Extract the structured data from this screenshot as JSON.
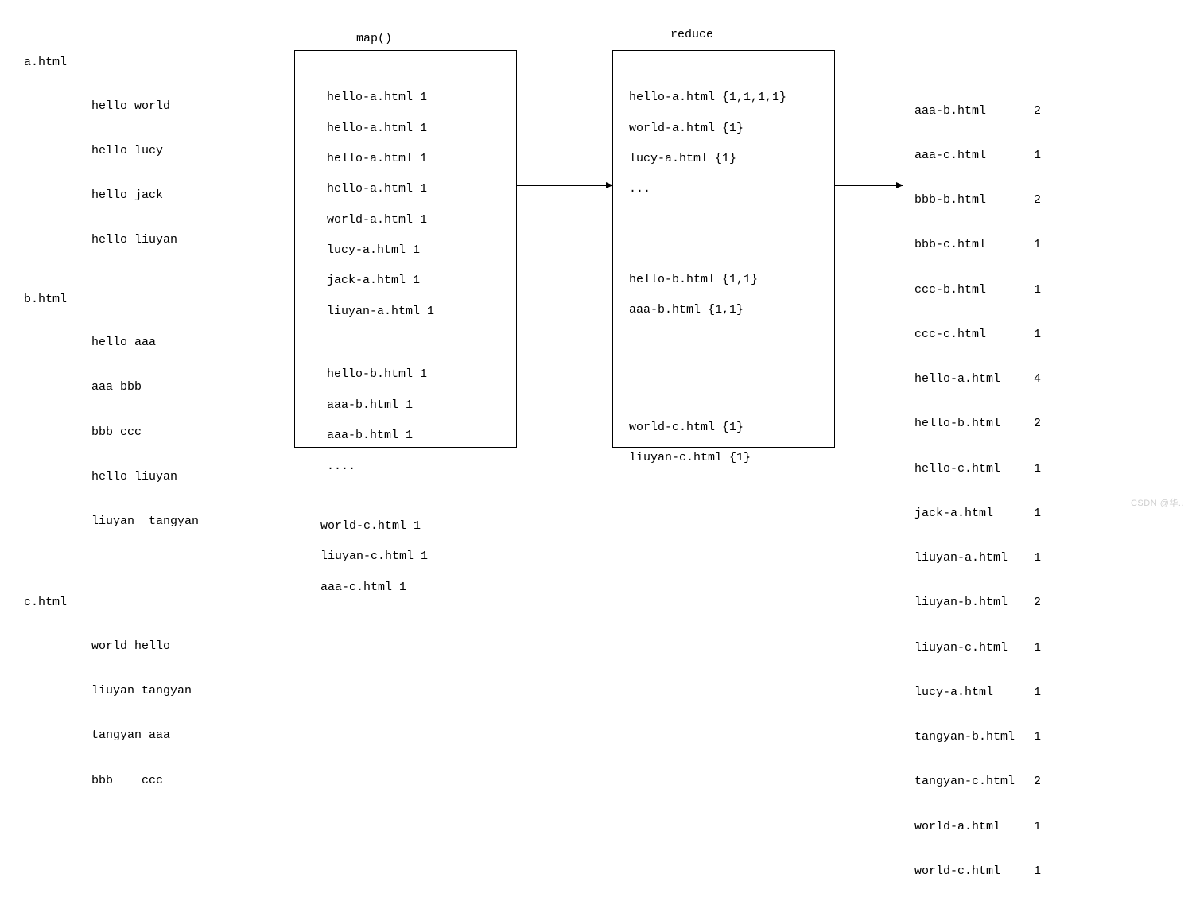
{
  "labels": {
    "map": "map()",
    "reduce": "reduce"
  },
  "inputs": {
    "a": {
      "name": "a.html",
      "lines": [
        "hello world",
        "hello lucy",
        "hello jack",
        "hello liuyan"
      ]
    },
    "dots": ". . .",
    "b": {
      "name": "b.html",
      "lines": [
        "hello aaa",
        "aaa bbb",
        "bbb ccc",
        "hello liuyan",
        "liuyan  tangyan"
      ]
    },
    "c": {
      "name": "c.html",
      "lines": [
        "world hello",
        "liuyan tangyan",
        "tangyan aaa",
        "bbb    ccc"
      ]
    }
  },
  "map_box": {
    "group1": [
      "hello-a.html 1",
      "hello-a.html 1",
      "hello-a.html 1",
      "hello-a.html 1",
      "world-a.html 1",
      "lucy-a.html 1",
      "jack-a.html 1",
      "liuyan-a.html 1"
    ],
    "group2": [
      "hello-b.html 1",
      "aaa-b.html 1",
      "aaa-b.html 1",
      "...."
    ],
    "group3": [
      "world-c.html 1",
      "liuyan-c.html 1",
      "aaa-c.html 1"
    ]
  },
  "reduce_box": {
    "group1": [
      "hello-a.html {1,1,1,1}",
      "world-a.html {1}",
      "lucy-a.html {1}",
      "..."
    ],
    "group2": [
      "hello-b.html {1,1}",
      "aaa-b.html {1,1}"
    ],
    "group3": [
      "world-c.html {1}",
      "liuyan-c.html {1}"
    ]
  },
  "output": [
    {
      "k": "aaa-b.html",
      "v": "2"
    },
    {
      "k": "aaa-c.html",
      "v": "1"
    },
    {
      "k": "bbb-b.html",
      "v": "2"
    },
    {
      "k": "bbb-c.html",
      "v": "1"
    },
    {
      "k": "ccc-b.html",
      "v": "1"
    },
    {
      "k": "ccc-c.html",
      "v": "1"
    },
    {
      "k": "hello-a.html",
      "v": "4"
    },
    {
      "k": "hello-b.html",
      "v": "2"
    },
    {
      "k": "hello-c.html",
      "v": "1"
    },
    {
      "k": "jack-a.html",
      "v": "1"
    },
    {
      "k": "liuyan-a.html",
      "v": "1"
    },
    {
      "k": "liuyan-b.html",
      "v": "2"
    },
    {
      "k": "liuyan-c.html",
      "v": "1"
    },
    {
      "k": "lucy-a.html",
      "v": "1"
    },
    {
      "k": "tangyan-b.html",
      "v": "1"
    },
    {
      "k": "tangyan-c.html",
      "v": "2"
    },
    {
      "k": "world-a.html",
      "v": "1"
    },
    {
      "k": "world-c.html",
      "v": "1"
    }
  ],
  "watermark": "CSDN @华.."
}
